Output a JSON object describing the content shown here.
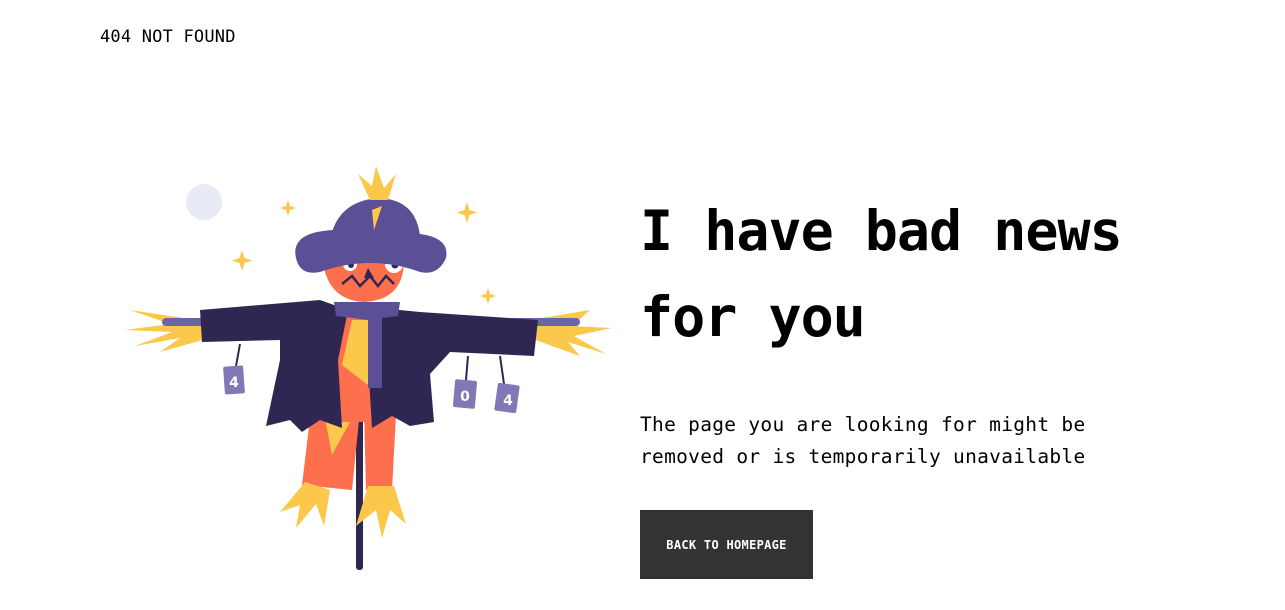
{
  "header": {
    "label": "404 NOT FOUND"
  },
  "main": {
    "headline": "I have bad news for you",
    "message": "The page you are looking for might be removed or is temporarily unavailable",
    "button_label": "BACK TO HOMEPAGE"
  },
  "illustration": {
    "tags": [
      "4",
      "0",
      "4"
    ],
    "colors": {
      "hat": "#5b4f96",
      "coat": "#2f2752",
      "face": "#fe6f4d",
      "straw": "#fbc84b",
      "moon": "#e8eaf5",
      "pole": "#2f2752"
    }
  },
  "button_color": "#333333"
}
